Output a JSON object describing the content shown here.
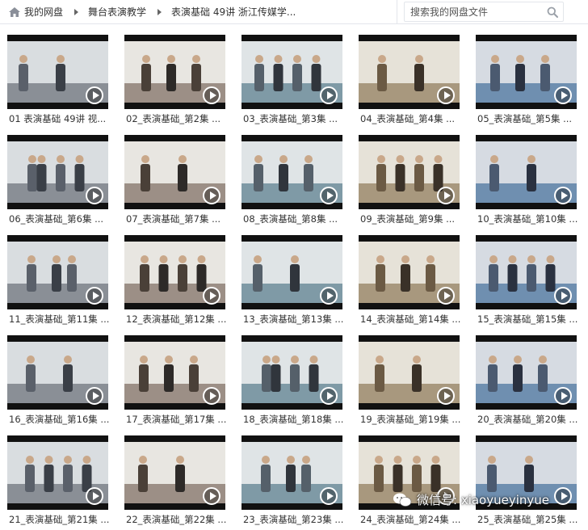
{
  "breadcrumb": {
    "items": [
      "我的网盘",
      "舞台表演教学",
      "表演基础 49讲 浙江传媒学..."
    ]
  },
  "search": {
    "placeholder": "搜索我的网盘文件"
  },
  "files": [
    {
      "caption": "01 表演基础 49讲 视..."
    },
    {
      "caption": "02_表演基础_第2集 ..."
    },
    {
      "caption": "03_表演基础_第3集 ..."
    },
    {
      "caption": "04_表演基础_第4集 ..."
    },
    {
      "caption": "05_表演基础_第5集 ..."
    },
    {
      "caption": "06_表演基础_第6集 ..."
    },
    {
      "caption": "07_表演基础_第7集 ..."
    },
    {
      "caption": "08_表演基础_第8集 ..."
    },
    {
      "caption": "09_表演基础_第9集 ..."
    },
    {
      "caption": "10_表演基础_第10集 ..."
    },
    {
      "caption": "11_表演基础_第11集 ..."
    },
    {
      "caption": "12_表演基础_第12集 ..."
    },
    {
      "caption": "13_表演基础_第13集 ..."
    },
    {
      "caption": "14_表演基础_第14集 ..."
    },
    {
      "caption": "15_表演基础_第15集 ..."
    },
    {
      "caption": "16_表演基础_第16集 ..."
    },
    {
      "caption": "17_表演基础_第17集 ..."
    },
    {
      "caption": "18_表演基础_第18集 ..."
    },
    {
      "caption": "19_表演基础_第19集 ..."
    },
    {
      "caption": "20_表演基础_第20集 ..."
    },
    {
      "caption": "21_表演基础_第21集 ..."
    },
    {
      "caption": "22_表演基础_第22集 ..."
    },
    {
      "caption": "23_表演基础_第23集 ..."
    },
    {
      "caption": "24_表演基础_第24集 ..."
    },
    {
      "caption": "25_表演基础_第25集 ..."
    }
  ],
  "watermark": {
    "text": "微信号: xiaoyueyinyue"
  },
  "colors": {
    "border": "#e3e6eb",
    "text": "#333333",
    "thumb_frame": "#111111"
  }
}
